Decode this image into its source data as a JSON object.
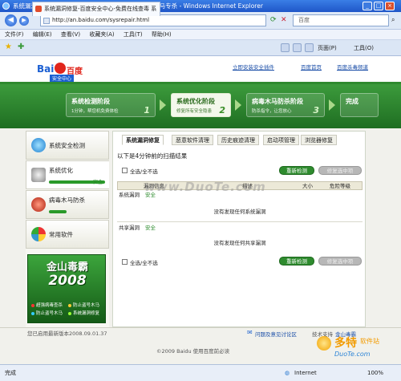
{
  "window": {
    "title": "系统漏洞修复-百度安全中心-免费在线查毒 系统优化 木马专杀 - Windows Internet Explorer",
    "min": "_",
    "max": "□",
    "close": "×"
  },
  "address": {
    "url": "http://an.baidu.com/sysrepair.html",
    "search_placeholder": "百度"
  },
  "menu": [
    "文件(F)",
    "编辑(E)",
    "查看(V)",
    "收藏夹(A)",
    "工具(T)",
    "帮助(H)"
  ],
  "tab": {
    "title": "系统漏洞修复-百度安全中心-免费在线查毒 系"
  },
  "toolbar": {
    "page": "页面(P)",
    "tools": "工具(O)"
  },
  "header": {
    "logo_top": "Bai",
    "logo_mid": "百度",
    "logo_sub": "安全中心",
    "links": [
      "立即安装安全插件",
      "百度首页",
      "百度杀毒频道"
    ]
  },
  "steps": [
    {
      "title": "系统检测阶段",
      "sub": "1分钟，帮您机免费体检",
      "num": "1"
    },
    {
      "title": "系统优化阶段",
      "sub": "修复所有安全隐患",
      "num": "2"
    },
    {
      "title": "病毒木马防杀阶段",
      "sub": "防杀指令，让您放心",
      "num": "3"
    },
    {
      "title": "完成",
      "sub": "",
      "num": ""
    }
  ],
  "sidebar": {
    "items": [
      {
        "label": "系统安全检测"
      },
      {
        "label": "系统优化",
        "status": "安全"
      },
      {
        "label": "病毒木马防杀"
      },
      {
        "label": "常用软件"
      }
    ]
  },
  "king": {
    "line1": "金山毒霸",
    "line2": "2008",
    "features": [
      "超强病毒查杀",
      "防止盗号木马",
      "防止盗号木马",
      "系统漏洞修复"
    ]
  },
  "main": {
    "tabs": [
      "系统漏洞修复",
      "恶意软件清理",
      "历史痕迹清理",
      "启动项管理",
      "浏览器修复"
    ],
    "scan_result": "以下是4分钟前的扫描结果",
    "select_all": "全选/全不选",
    "rescan": "重新检测",
    "fix": "修复选中项",
    "columns": [
      "漏洞信息",
      "描述",
      "大小",
      "危险等级"
    ],
    "sections": [
      {
        "name": "系统漏洞",
        "status": "安全",
        "empty": "没有发现任何系统漏洞"
      },
      {
        "name": "共享漏洞",
        "status": "安全",
        "empty": "没有发现任何共享漏洞"
      }
    ]
  },
  "footer": {
    "updated": "您已启用最新版本2008.09.01.37",
    "feedback": "问题及意见讨论区",
    "support": "技术支持",
    "kingsoft": "金山毒霸",
    "copyright": "©2009 Baidu 使用百度前必读"
  },
  "watermark": "www.DuoTe.com",
  "duote": {
    "name": "多特",
    "site": "DuoTe.com",
    "sub": "软件站"
  },
  "status": {
    "left": "完成",
    "zone": "Internet",
    "zoom": "100%"
  },
  "colors": {
    "green": "#2e8b2e",
    "ie_blue": "#1f56c8",
    "link": "#1c4fa8"
  }
}
